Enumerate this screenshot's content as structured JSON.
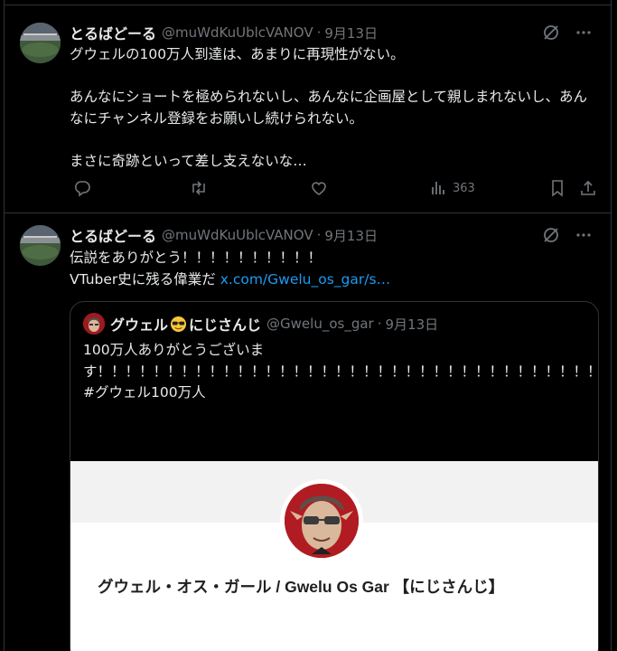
{
  "tweets": [
    {
      "name": "とるばどーる",
      "handle": "@muWdKuUblcVANOV",
      "separator": "·",
      "date": "9月13日",
      "paragraphs": [
        "グウェルの100万人到達は、あまりに再現性がない。",
        "",
        "あんなにショートを極められないし、あんなに企画屋として親しまれないし、あんなにチャンネル登録をお願いし続けられない。",
        "",
        "まさに奇跡といって差し支えないな…"
      ],
      "views": "363"
    },
    {
      "name": "とるばどーる",
      "handle": "@muWdKuUblcVANOV",
      "separator": "·",
      "date": "9月13日",
      "line1": "伝説をありがとう！！！！！！！！！！",
      "line2_prefix": "VTuber史に残る偉業だ ",
      "line2_link": "x.com/Gwelu_os_gar/s…"
    }
  ],
  "quote": {
    "name_part1": "グウェル",
    "emoji": "sunglasses-emoji",
    "name_part2": "にじさんじ",
    "handle": "@Gwelu_os_gar",
    "separator": "·",
    "date": "9月13日",
    "text": "100万人ありがとうございます！！！！！！！！！！！！！！！！！！！！！！！！！！！！！！！！！！！！！！！！！！！！！！！！！！！！！！！！！！！！！！！！！！",
    "hashtag": "#グウェル100万人",
    "card_title": "グウェル・オス・ガール / Gwelu Os Gar 【にじさんじ】"
  },
  "colors": {
    "background": "#000000",
    "text": "#e7e9ea",
    "muted": "#71767b",
    "link": "#1d9bf0",
    "border": "#2f3336"
  }
}
